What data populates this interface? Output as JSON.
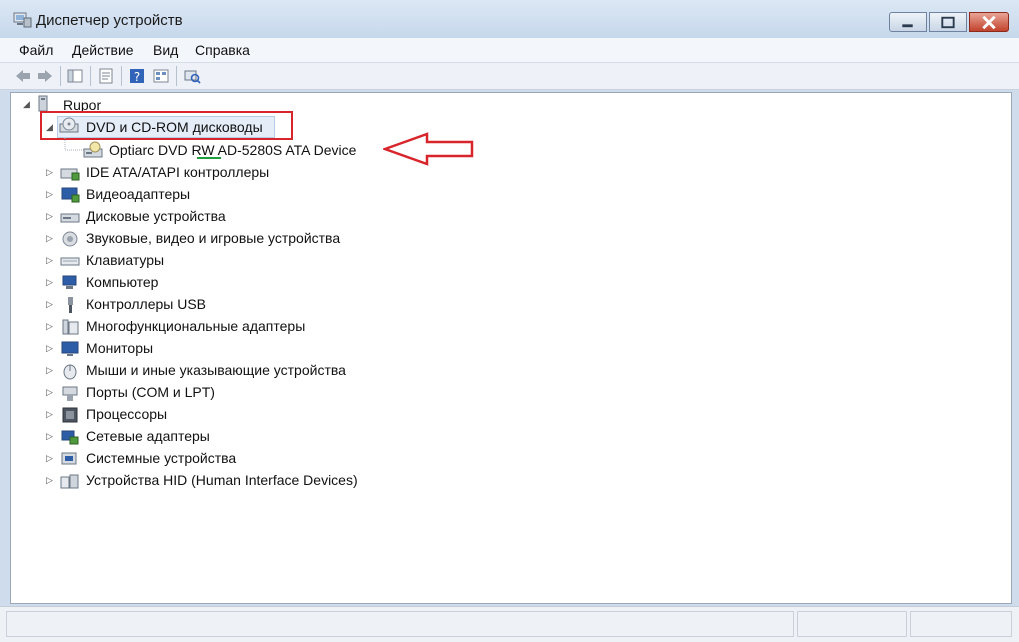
{
  "window": {
    "title": "Диспетчер устройств"
  },
  "menu": [
    "Файл",
    "Действие",
    "Вид",
    "Справка"
  ],
  "tree": {
    "root": "Rupor",
    "expanded_category": "DVD и CD-ROM дисководы",
    "child_device": "Optiarc DVD RW AD-5280S ATA Device",
    "categories": [
      "IDE ATA/ATAPI контроллеры",
      "Видеоадаптеры",
      "Дисковые устройства",
      "Звуковые, видео и игровые устройства",
      "Клавиатуры",
      "Компьютер",
      "Контроллеры USB",
      "Многофункциональные адаптеры",
      "Мониторы",
      "Мыши и иные указывающие устройства",
      "Порты (COM и LPT)",
      "Процессоры",
      "Сетевые адаптеры",
      "Системные устройства",
      "Устройства HID (Human Interface Devices)"
    ]
  },
  "colors": {
    "highlight": "#d8242b",
    "arrow": "#d8242b",
    "underline": "#1f9e3f"
  }
}
